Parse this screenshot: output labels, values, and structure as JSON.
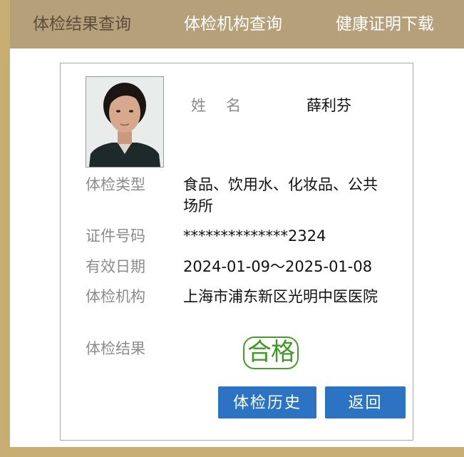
{
  "nav": {
    "items": [
      {
        "label": "体检结果查询",
        "active": false
      },
      {
        "label": "体检机构查询",
        "active": true
      },
      {
        "label": "健康证明下载",
        "active": true
      }
    ]
  },
  "profile": {
    "name_label": "姓名",
    "name_value": "薛利芬",
    "photo_icon": "person-photo"
  },
  "fields": {
    "type_label": "体检类型",
    "type_value": "食品、饮用水、化妆品、公共场所",
    "id_label": "证件号码",
    "id_value": "**************2324",
    "date_label": "有效日期",
    "date_value": "2024-01-09～2025-01-08",
    "org_label": "体检机构",
    "org_value": "上海市浦东新区光明中医医院",
    "result_label": "体检结果",
    "result_value": "合格"
  },
  "buttons": {
    "history": "体检历史",
    "back": "返回"
  },
  "colors": {
    "frame": "#c9ae73",
    "nav_bg": "#b6a07a",
    "button": "#2c73c3",
    "stamp": "#3f9a25"
  }
}
